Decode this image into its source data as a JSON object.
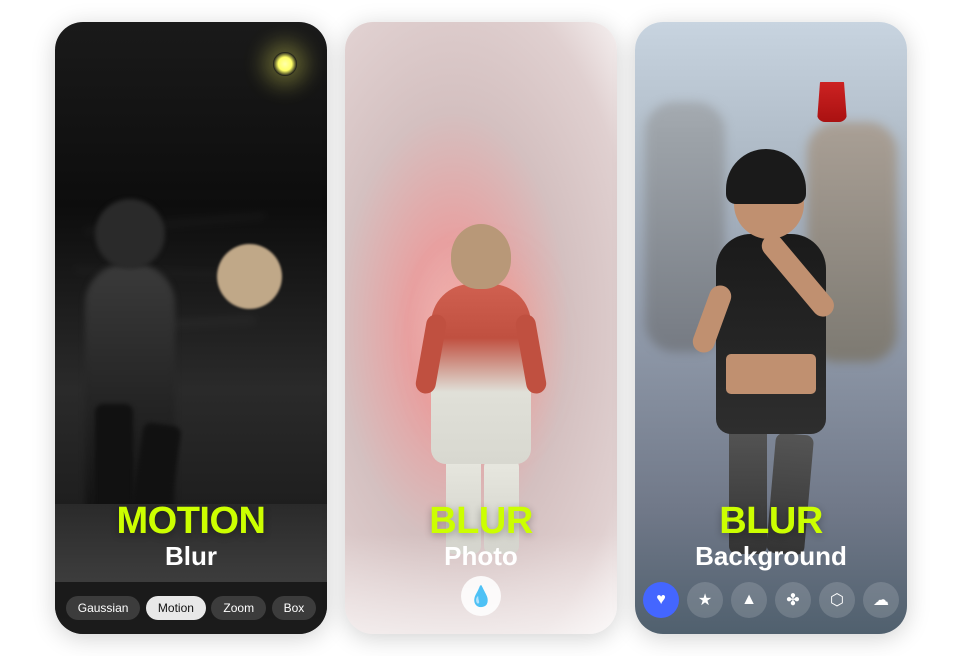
{
  "cards": [
    {
      "id": "motion-blur",
      "label_main": "MOTION",
      "label_sub": "Blur",
      "filter_chips": [
        {
          "label": "Gaussian",
          "active": false
        },
        {
          "label": "Motion",
          "active": true
        },
        {
          "label": "Zoom",
          "active": false
        },
        {
          "label": "Box",
          "active": false
        }
      ]
    },
    {
      "id": "blur-photo",
      "label_main": "BLUR",
      "label_sub": "Photo",
      "bottom_icon": "💧"
    },
    {
      "id": "blur-background",
      "label_main": "BLUR",
      "label_sub": "Background",
      "bottom_icons": [
        {
          "icon": "♥",
          "class": "icon-heart"
        },
        {
          "icon": "★",
          "class": "icon-star"
        },
        {
          "icon": "▲",
          "class": "icon-tri"
        },
        {
          "icon": "✤",
          "class": "icon-game"
        },
        {
          "icon": "⬡",
          "class": "icon-cam"
        },
        {
          "icon": "☁",
          "class": "icon-cloud"
        }
      ]
    }
  ]
}
